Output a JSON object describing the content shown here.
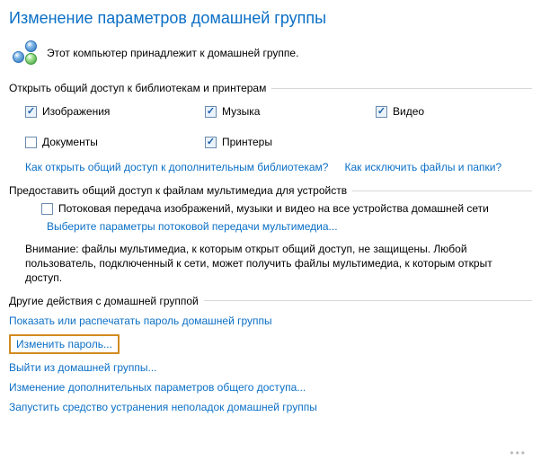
{
  "title": "Изменение параметров домашней группы",
  "header": {
    "text": "Этот компьютер принадлежит к домашней группе."
  },
  "section_libraries": {
    "label": "Открыть общий доступ к библиотекам и принтерам",
    "items": [
      {
        "label": "Изображения",
        "checked": true
      },
      {
        "label": "Музыка",
        "checked": true
      },
      {
        "label": "Видео",
        "checked": true
      },
      {
        "label": "Документы",
        "checked": false
      },
      {
        "label": "Принтеры",
        "checked": true
      }
    ],
    "links": {
      "additional_libs": "Как открыть общий доступ к дополнительным библиотекам?",
      "exclude_files": "Как исключить файлы и папки?"
    }
  },
  "section_media": {
    "label": "Предоставить общий доступ к файлам мультимедиа для устройств",
    "streaming_checkbox": {
      "label": "Потоковая передача изображений, музыки и видео на все устройства домашней сети",
      "checked": false
    },
    "choose_params_link": "Выберите параметры потоковой передачи мультимедиа...",
    "warning": "Внимание: файлы мультимедиа, к которым открыт общий доступ, не защищены. Любой пользователь, подключенный к сети, может получить файлы мультимедиа, к которым открыт доступ."
  },
  "section_other": {
    "label": "Другие действия с домашней группой",
    "items": [
      "Показать или распечатать пароль домашней группы",
      "Изменить пароль...",
      "Выйти из домашней группы...",
      "Изменение дополнительных параметров общего доступа...",
      "Запустить средство устранения неполадок домашней группы"
    ],
    "highlighted_index": 1
  }
}
